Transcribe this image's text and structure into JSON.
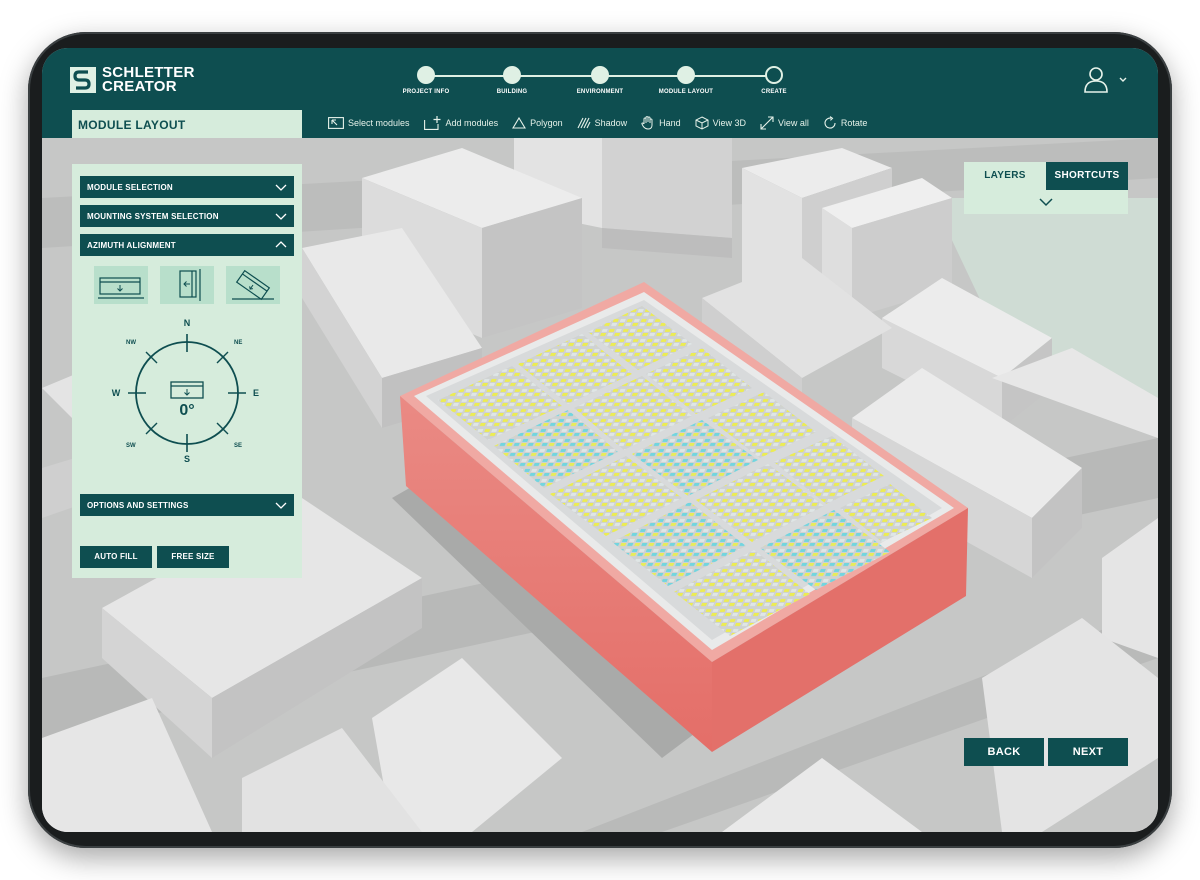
{
  "brand": {
    "line1": "SCHLETTER",
    "line2": "CREATOR"
  },
  "steps": [
    {
      "label": "PROJECT INFO",
      "done": true
    },
    {
      "label": "BUILDING",
      "done": true
    },
    {
      "label": "ENVIRONMENT",
      "done": true
    },
    {
      "label": "MODULE LAYOUT",
      "done": true
    },
    {
      "label": "CREATE",
      "done": false
    }
  ],
  "section_title": "MODULE LAYOUT",
  "toolbar": {
    "select": "Select modules",
    "add": "Add modules",
    "polygon": "Polygon",
    "shadow": "Shadow",
    "hand": "Hand",
    "view3d": "View 3D",
    "viewall": "View all",
    "rotate": "Rotate"
  },
  "panel": {
    "module_selection": "MODULE SELECTION",
    "mounting_selection": "MOUNTING SYSTEM SELECTION",
    "azimuth": "AZIMUTH ALIGNMENT",
    "options": "OPTIONS AND SETTINGS",
    "auto_fill": "AUTO FILL",
    "free_size": "FREE SIZE"
  },
  "compass": {
    "n": "N",
    "s": "S",
    "e": "E",
    "w": "W",
    "nw": "NW",
    "ne": "NE",
    "sw": "SW",
    "se": "SE",
    "angle": "0°"
  },
  "layers": {
    "layers": "LAYERS",
    "shortcuts": "SHORTCUTS",
    "active": "shortcuts"
  },
  "nav": {
    "back": "BACK",
    "next": "NEXT"
  },
  "colors": {
    "primary": "#0e4e50",
    "panel": "#d6ecdc",
    "accent_building": "#e98a82",
    "module_yellow": "#f0ea4a",
    "module_cyan": "#6fd6e0"
  },
  "icons": {
    "user": "user-icon",
    "chevron": "chevron-down-icon",
    "compass": "compass-icon"
  }
}
